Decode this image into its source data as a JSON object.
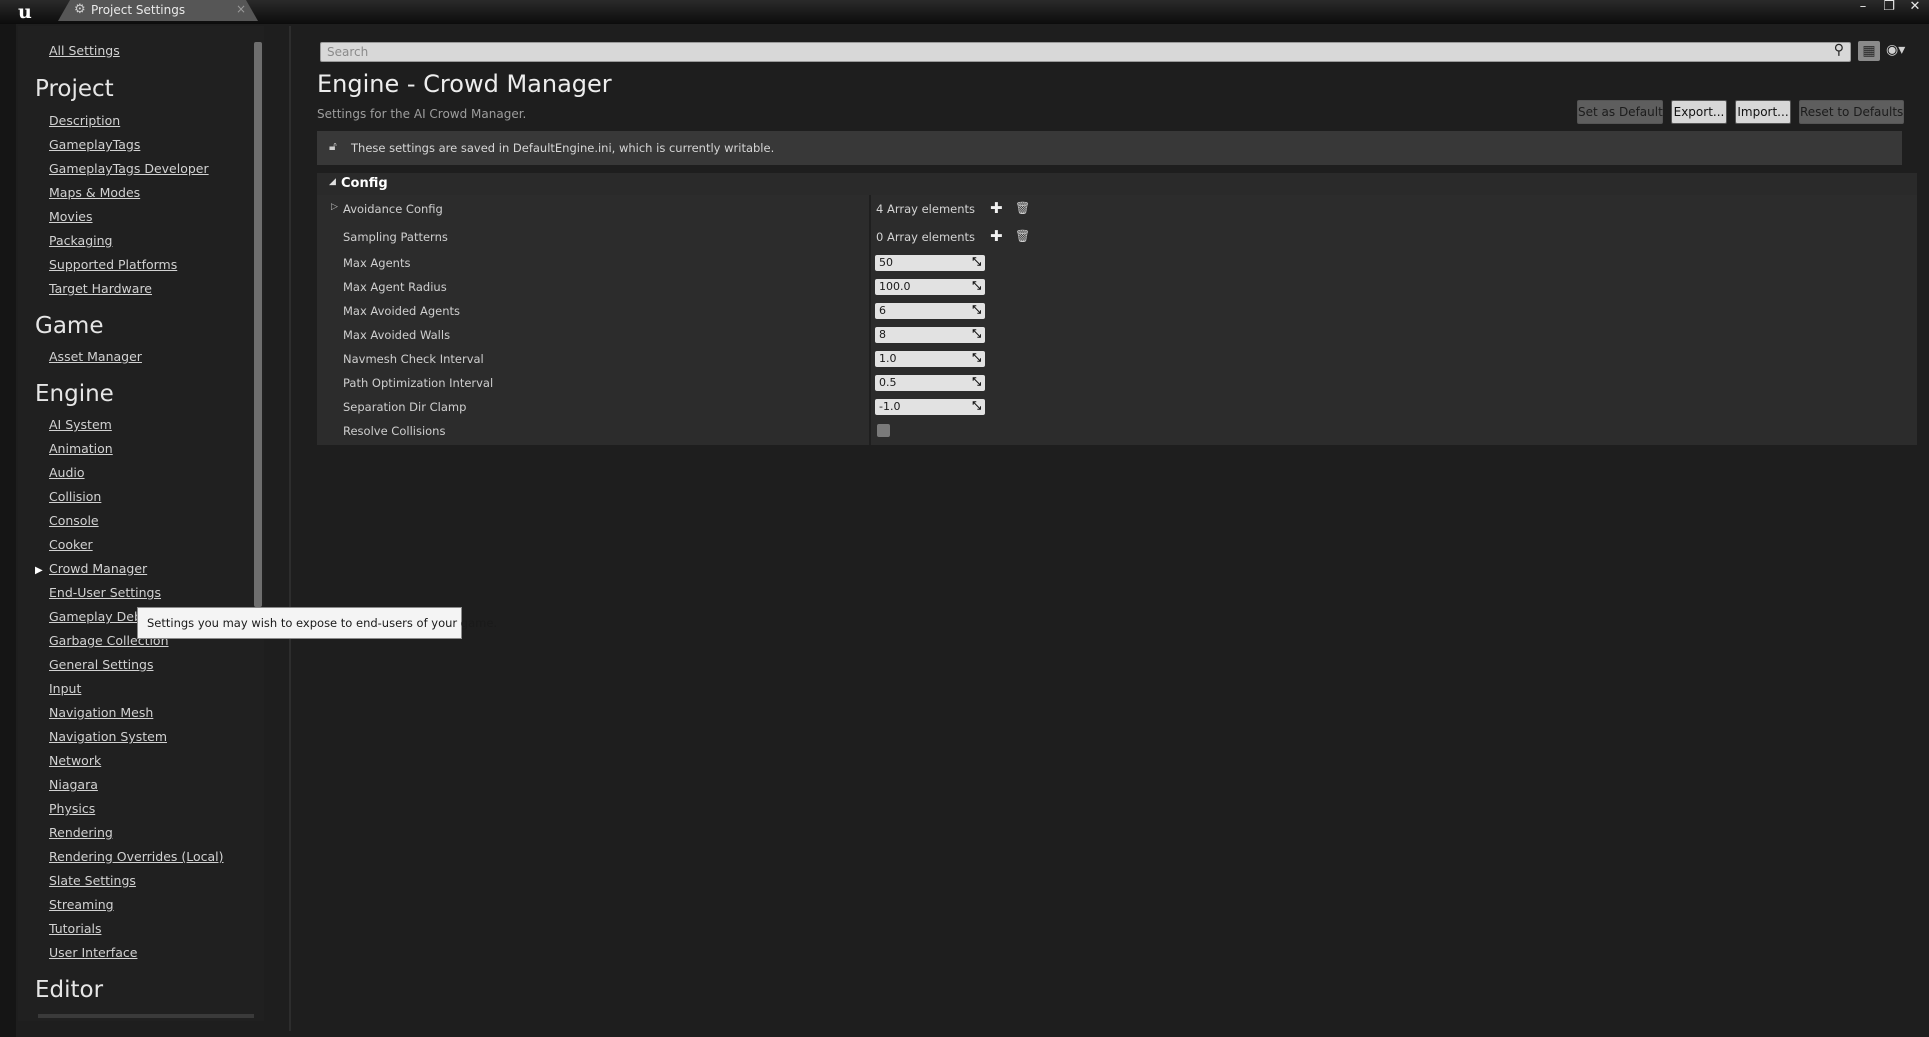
{
  "window": {
    "tab_title": "Project Settings",
    "controls": {
      "minimize": "–",
      "restore": "❐",
      "close": "✕"
    }
  },
  "sidebar": {
    "all_settings": "All Settings",
    "project_heading": "Project",
    "project_items": [
      "Description",
      "GameplayTags",
      "GameplayTags Developer",
      "Maps & Modes",
      "Movies",
      "Packaging",
      "Supported Platforms",
      "Target Hardware"
    ],
    "game_heading": "Game",
    "game_items": [
      "Asset Manager"
    ],
    "engine_heading": "Engine",
    "engine_items": [
      "AI System",
      "Animation",
      "Audio",
      "Collision",
      "Console",
      "Cooker",
      "Crowd Manager",
      "End-User Settings",
      "Gameplay Debu",
      "Garbage Collection",
      "General Settings",
      "Input",
      "Navigation Mesh",
      "Navigation System",
      "Network",
      "Niagara",
      "Physics",
      "Rendering",
      "Rendering Overrides (Local)",
      "Slate Settings",
      "Streaming",
      "Tutorials",
      "User Interface"
    ],
    "editor_heading": "Editor",
    "selected_item": "Crowd Manager"
  },
  "tooltip": {
    "text": "Settings you may wish to expose to end-users of your game."
  },
  "search": {
    "placeholder": "Search"
  },
  "header": {
    "title": "Engine - Crowd Manager",
    "subtitle": "Settings for the AI Crowd Manager.",
    "buttons": {
      "set_default": "Set as Default",
      "export": "Export...",
      "import": "Import...",
      "reset": "Reset to Defaults"
    }
  },
  "notice": {
    "text": "These settings are saved in DefaultEngine.ini, which is currently writable."
  },
  "config": {
    "section_title": "Config",
    "avoidance_config": {
      "label": "Avoidance Config",
      "value": "4 Array elements"
    },
    "sampling_patterns": {
      "label": "Sampling Patterns",
      "value": "0 Array elements"
    },
    "max_agents": {
      "label": "Max Agents",
      "value": "50"
    },
    "max_agent_radius": {
      "label": "Max Agent Radius",
      "value": "100.0"
    },
    "max_avoided_agents": {
      "label": "Max Avoided Agents",
      "value": "6"
    },
    "max_avoided_walls": {
      "label": "Max Avoided Walls",
      "value": "8"
    },
    "navmesh_check_interval": {
      "label": "Navmesh Check Interval",
      "value": "1.0"
    },
    "path_optimization_interval": {
      "label": "Path Optimization Interval",
      "value": "0.5"
    },
    "separation_dir_clamp": {
      "label": "Separation Dir Clamp",
      "value": "-1.0"
    },
    "resolve_collisions": {
      "label": "Resolve Collisions",
      "checked": false
    }
  }
}
